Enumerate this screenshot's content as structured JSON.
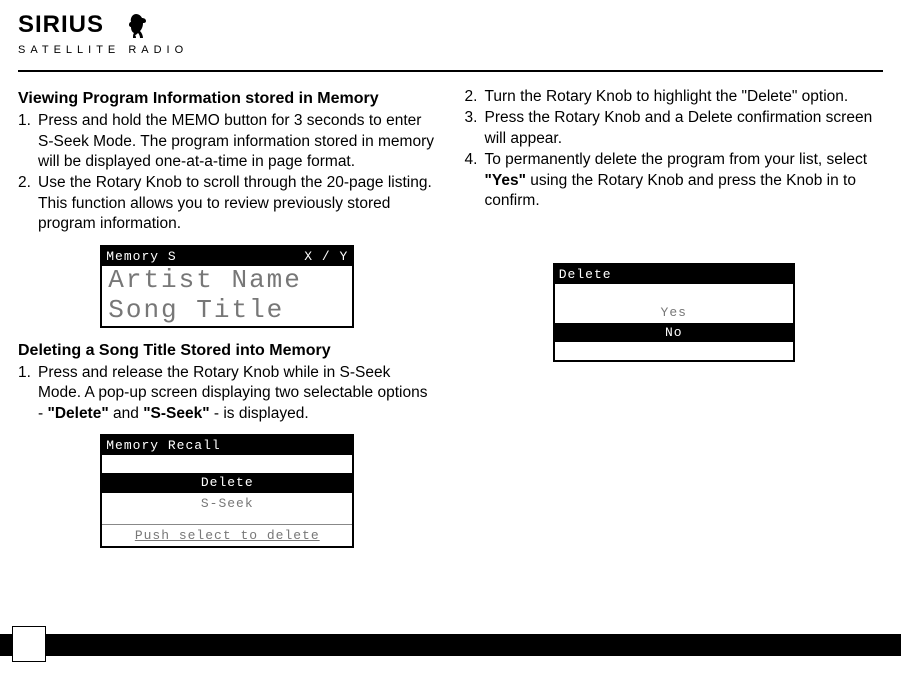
{
  "brand": {
    "name": "SIRIUS",
    "sub": "SATELLITE  RADIO"
  },
  "left": {
    "h1": "Viewing Program Information stored in Memory",
    "s1": "Press and hold the MEMO button for 3 seconds to enter S-Seek Mode. The program information stored in memory will be displayed one-at-a-time in page format.",
    "s2": "Use the Rotary Knob to scroll through the 20-page listing. This function allows you to review previously stored program information.",
    "lcd1": {
      "bar_l": "Memory  S",
      "bar_r": "X / Y",
      "line1": "Artist Name",
      "line2": "Song Title"
    },
    "h2": "Deleting a Song Title Stored into Memory",
    "s3a": "Press and release the Rotary Knob while in S-Seek Mode.  A pop-up screen displaying two selectable options - ",
    "s3b": "\"Delete\"",
    "s3c": " and ",
    "s3d": "\"S-Seek\"",
    "s3e": " - is displayed.",
    "lcd2": {
      "bar": "Memory Recall",
      "opt1": "Delete",
      "opt2": "S-Seek",
      "hint": "Push select to delete"
    }
  },
  "right": {
    "s2": "Turn the Rotary Knob to highlight the \"Delete\" option.",
    "s3": "Press the Rotary Knob and a Delete confirmation screen will appear.",
    "s4a": "To permanently delete the program from your list, select ",
    "s4b": "\"Yes\"",
    "s4c": " using the Rotary Knob and press the Knob in to confirm.",
    "lcd3": {
      "bar": "Delete",
      "yes": "Yes",
      "no": "No"
    }
  },
  "nums": {
    "n1": "1.",
    "n2": "2.",
    "n3": "3.",
    "n4": "4."
  }
}
